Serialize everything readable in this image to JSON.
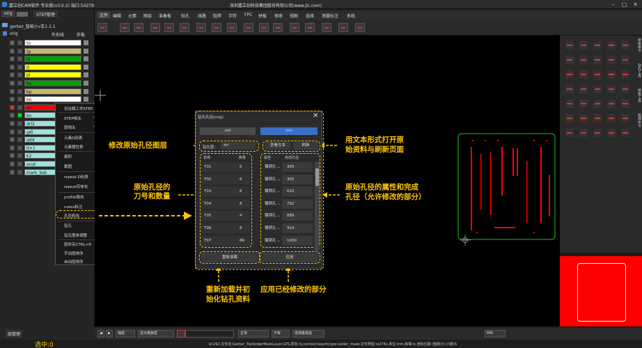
{
  "titlebar": {
    "title": "嘉立创CAM软件 专业版(v3.0.2) 端口:54278",
    "company": "深圳嘉立创科技集团股份有限公司(www.jlc.com)"
  },
  "left": {
    "tabs": [
      "orig",
      "STEP管理"
    ],
    "gerber_name": "gerber_智能小v车1.1.1",
    "step": "orig",
    "outline_label": "外形线",
    "bend_label": "折板",
    "bottom_label": "层管理",
    "selected": "选中:0"
  },
  "layers": [
    {
      "name": "to",
      "color": "#ffffff"
    },
    {
      "name": "tp",
      "color": "#c8b96e"
    },
    {
      "name": "ts",
      "color": "#00a000"
    },
    {
      "name": "tl",
      "color": "#ffff00"
    },
    {
      "name": "bl",
      "color": "#ffff00"
    },
    {
      "name": "bs",
      "color": "#00a000"
    },
    {
      "name": "bp",
      "color": "#c8b96e"
    },
    {
      "name": "bo",
      "color": "#ffffff"
    },
    {
      "name": "drl",
      "color": "#ff0000"
    },
    {
      "name": "ko",
      "color": "#a0e0e0"
    },
    {
      "name": "drl2",
      "color": "#a0e0e0"
    },
    {
      "name": "gdl",
      "color": "#a0e0e0"
    },
    {
      "name": "gdd",
      "color": "#a0e0e0"
    },
    {
      "name": "tl+1",
      "color": "#a0e0e0"
    },
    {
      "name": "k2",
      "color": "#a0e0e0"
    },
    {
      "name": "vcut",
      "color": "#a0e0e0"
    },
    {
      "name": "mark_bak",
      "color": "#a0e0e0"
    }
  ],
  "context_menu": [
    "仅挂载工作STEP",
    "STEP相关",
    "层相关",
    "元素D码表",
    "元素属性表",
    "面积",
    "截图",
    "repeat D码表",
    "repeat实体化",
    "profile填充",
    "notes标注",
    "孔径修改",
    "钻孔",
    "钻孔图参调整",
    "层命名CTRL+R",
    "手动层排序",
    "自动层排序"
  ],
  "menubar": [
    "文件",
    "编辑",
    "元素",
    "图层",
    "准备板",
    "钻孔",
    "线路",
    "阻焊",
    "字符",
    "FPC",
    "拼板",
    "修审",
    "视图",
    "选择",
    "测量标注",
    "系统"
  ],
  "dialog": {
    "title": "钻孔孔径(orig)",
    "unit_mil": "mil",
    "unit_mm": "mm",
    "layer_label": "钻孔层:",
    "layer_value": "drl",
    "view_text": "查看文本",
    "refresh": "刷新",
    "col_name": "名称",
    "col_qty": "数量",
    "col_attr": "属性",
    "col_finish": "完成孔径",
    "reload": "重新加载",
    "apply": "应用"
  },
  "holes": [
    {
      "name": "T01",
      "qty": "6",
      "attr": "镀铜孔",
      "size": "305"
    },
    {
      "name": "T02",
      "qty": "6",
      "attr": "镀铜孔",
      "size": "305"
    },
    {
      "name": "T03",
      "qty": "8",
      "attr": "镀铜孔",
      "size": "610"
    },
    {
      "name": "T04",
      "qty": "8",
      "attr": "镀铜孔",
      "size": "762"
    },
    {
      "name": "T05",
      "qty": "4",
      "attr": "镀铜孔",
      "size": "889"
    },
    {
      "name": "T06",
      "qty": "8",
      "attr": "镀铜孔",
      "size": "914"
    },
    {
      "name": "T07",
      "qty": "86",
      "attr": "镀铜孔",
      "size": "1000"
    }
  ],
  "annotations": {
    "a1": "修改原始孔径图层",
    "a2": "原始孔径的",
    "a2b": "刀号和数量",
    "a3": "用文本形式打开原",
    "a3b": "始资料与刷新页面",
    "a4": "原始孔径的属性和完成",
    "a4b": "孔径（允许修改的部分）",
    "a5": "重新加载并初",
    "a5b": "始化钻孔资料",
    "a6": "应用已经修改的部分"
  },
  "right_tabs": [
    "拼板命令",
    "钻孔工具",
    "拼板工具",
    "阻焊命令"
  ],
  "bottombar": {
    "zoom": "缩放",
    "display_mode": "显示模板框",
    "normal": "正常",
    "panel_select": "平板",
    "overlay": "选择集相选",
    "unit": "MM"
  },
  "status": "id:292,文件名:Gerber_TopSolderMaskLayer.GTS,层名:ts,context:board,type:solder_mask,文件类型:rs274x,单位:mm,板等:lc,坐标位数:(整数)3 (小数)5",
  "icons": [
    "app-icon",
    "minimize-icon",
    "maximize-icon",
    "close-icon"
  ]
}
